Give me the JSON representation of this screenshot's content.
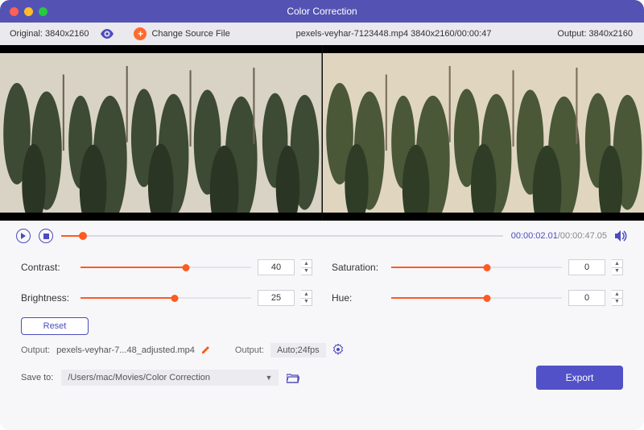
{
  "title": "Color Correction",
  "toolbar": {
    "original_label": "Original: 3840x2160",
    "change_source_label": "Change Source File",
    "file_info": "pexels-veyhar-7123448.mp4    3840x2160/00:00:47",
    "output_label": "Output: 3840x2160"
  },
  "playback": {
    "seek_pct": 5,
    "current_time": "00:00:02.01",
    "total_time": "/00:00:47.05"
  },
  "sliders": {
    "contrast": {
      "label": "Contrast:",
      "value": "40",
      "pct": 62
    },
    "brightness": {
      "label": "Brightness:",
      "value": "25",
      "pct": 55
    },
    "saturation": {
      "label": "Saturation:",
      "value": "0",
      "pct": 56
    },
    "hue": {
      "label": "Hue:",
      "value": "0",
      "pct": 56
    }
  },
  "reset_label": "Reset",
  "output": {
    "label": "Output:",
    "filename": "pexels-veyhar-7...48_adjusted.mp4",
    "format_label": "Output:",
    "format_value": "Auto;24fps"
  },
  "save": {
    "label": "Save to:",
    "path": "/Users/mac/Movies/Color Correction"
  },
  "export_label": "Export"
}
